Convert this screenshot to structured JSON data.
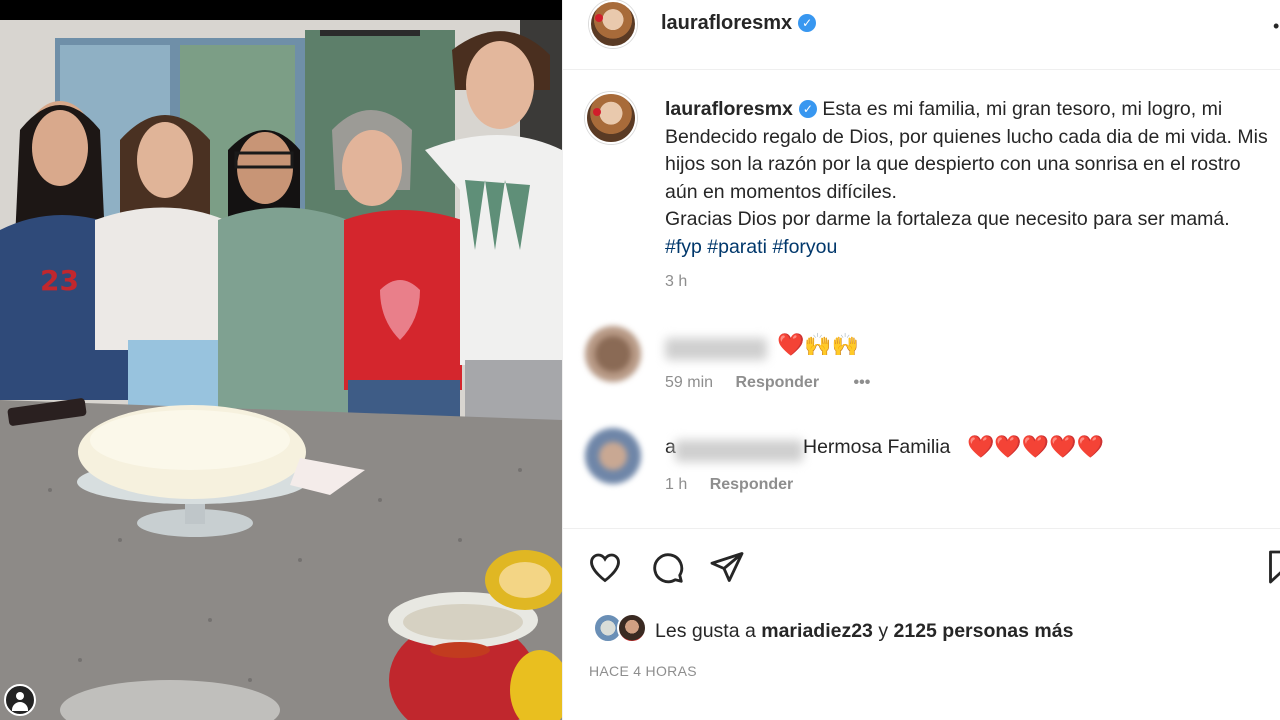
{
  "post": {
    "username": "laurafloresmx",
    "caption": "Esta es mi familia, mi gran tesoro, mi logro, mi Bendecido regalo de Dios, por quienes lucho cada dia de mi vida. Mis hijos son la razón por la que despierto con una sonrisa en el rostro aún en momentos difíciles.",
    "caption_line2": "Gracias Dios por darme la fortaleza que necesito para ser mamá.",
    "hashtags": "#fyp #parati #foryou",
    "time": "3 h"
  },
  "comments": [
    {
      "text": "",
      "hearts": "❤️🙌🙌",
      "time": "59 min",
      "reply": "Responder",
      "more": "•••"
    },
    {
      "name_prefix": "a",
      "text": "Hermosa Familia",
      "hearts": "❤️❤️❤️❤️❤️",
      "time": "1 h",
      "reply": "Responder"
    }
  ],
  "likes": {
    "prefix": "Les gusta a",
    "user": "mariadiez23",
    "connector": "y",
    "count_text": "2125 personas más"
  },
  "posted_ago": "HACE 4 HORAS",
  "colors": {
    "link": "#00376b",
    "verified": "#3897f0",
    "heart": "#e0101f",
    "muted": "#8e8e8e"
  },
  "icons": [
    "heart-icon",
    "comment-icon",
    "share-icon",
    "bookmark-icon",
    "verified-icon",
    "user-tag-icon"
  ]
}
